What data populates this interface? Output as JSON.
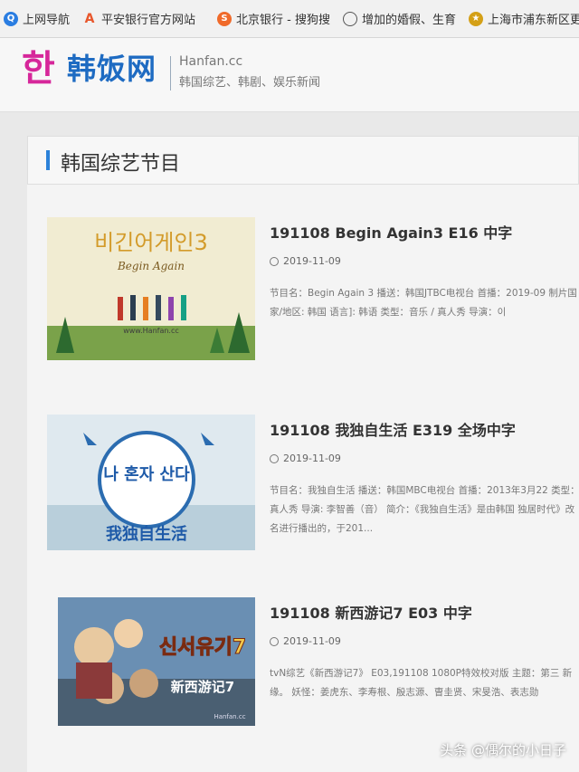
{
  "bookmarks": [
    {
      "label": "上网导航",
      "icon": "q-icon",
      "color": "#2a7de1"
    },
    {
      "label": "平安银行官方网站",
      "icon": "pingan-icon",
      "color": "#e8562b"
    },
    {
      "label": "北京银行 - 搜狗搜",
      "icon": "sogou-icon",
      "color": "#f06a2a"
    },
    {
      "label": "增加的婚假、生育",
      "icon": "globe-icon",
      "color": "#555555"
    },
    {
      "label": "上海市浦东新区更",
      "icon": "gov-icon",
      "color": "#d4a017"
    }
  ],
  "site": {
    "logo_han": "한",
    "logo_cn": "韩饭网",
    "domain": "Hanfan.cc",
    "tagline": "韩国综艺、韩剧、娱乐新闻"
  },
  "section": {
    "title": "韩国综艺节目"
  },
  "items": [
    {
      "title": "191108 Begin Again3 E16 中字",
      "date": "2019-11-09",
      "description": "节目名：Begin Again 3 播送：韩国JTBC电视台 首播：2019-09 制片国家/地区: 韩国 语言]: 韩语 类型：音乐 / 真人秀 导演：이",
      "thumb_text": "비긴어게인3",
      "thumb_sub": "Begin Again",
      "thumb_site": "www.Hanfan.cc"
    },
    {
      "title": "191108 我独自生活 E319 全场中字",
      "date": "2019-11-09",
      "description": "节目名：我独自生活 播送：韩国MBC电视台 首播：2013年3月22 类型：真人秀 导演: 李智善（音） 简介：《我独自生活》是由韩国 独居时代》改名进行播出的，于201...",
      "thumb_text": "나 혼자 산다",
      "thumb_sub": "我独自生活"
    },
    {
      "title": "191108 新西游记7 E03 中字",
      "date": "2019-11-09",
      "description": "tvN综艺《新西游记7》 E03,191108 1080P特效校对版 主题：第三 新缘。 妖怪：姜虎东、李寿根、殷志源、曺圭贤、宋旻浩、表志勋",
      "thumb_text": "신서유기7",
      "thumb_sub": "新西游记7",
      "thumb_site": "Hanfan.cc"
    }
  ],
  "watermark": "头条 @偶尔的小日子"
}
